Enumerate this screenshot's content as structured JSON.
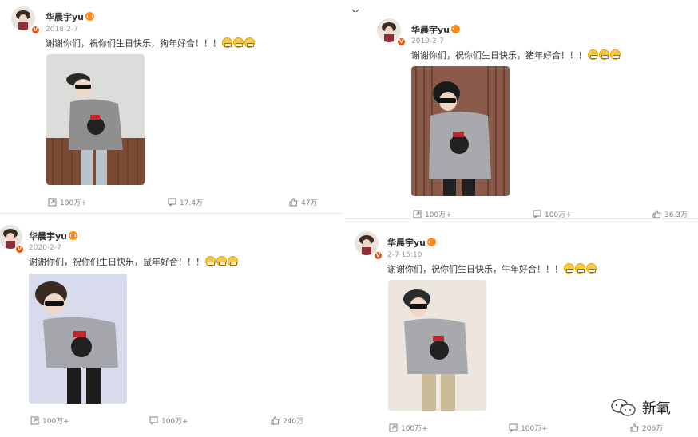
{
  "posts": [
    {
      "username": "华晨宇yu",
      "date": "2018-2-7",
      "text": "谢谢你们，祝你们生日快乐，狗年好合！！！",
      "repost_count": "100万+",
      "comment_count": "17.4万",
      "like_count": "47万"
    },
    {
      "username": "华晨宇yu",
      "date": "2019-2-7",
      "text": "谢谢你们，祝你们生日快乐，猪年好合！！！",
      "repost_count": "100万+",
      "comment_count": "100万+",
      "like_count": "36.3万"
    },
    {
      "username": "华晨宇yu",
      "date": "2020-2-7",
      "text": "谢谢你们，祝你们生日快乐，鼠年好合！！！",
      "repost_count": "100万+",
      "comment_count": "100万+",
      "like_count": "240万"
    },
    {
      "username": "华晨宇yu",
      "date": "2-7 15:10",
      "text": "谢谢你们，祝你们生日快乐，牛年好合！！！",
      "repost_count": "100万+",
      "comment_count": "100万+",
      "like_count": "206万"
    }
  ],
  "watermark": {
    "text": "新氧",
    "icon": "wechat-icon"
  },
  "colors": {
    "verified": "#e8530e",
    "crown": "#ff8c1a",
    "muted": "#808080"
  }
}
